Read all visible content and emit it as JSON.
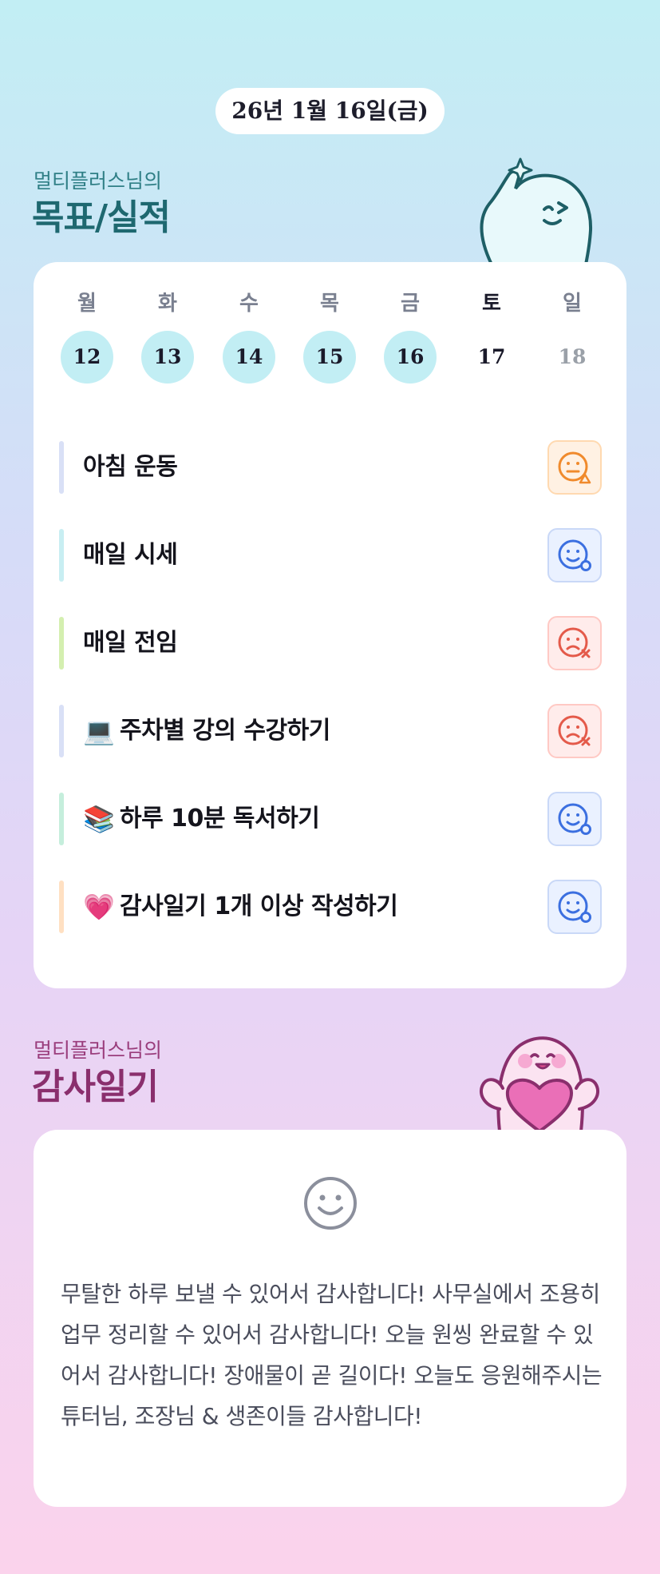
{
  "header": {
    "date": "26년 1월 16일(금)"
  },
  "goals_section": {
    "subtitle": "멀티플러스님의",
    "title": "목표/실적",
    "days": [
      {
        "label": "월",
        "num": "12",
        "state": "done"
      },
      {
        "label": "화",
        "num": "13",
        "state": "done"
      },
      {
        "label": "수",
        "num": "14",
        "state": "done"
      },
      {
        "label": "목",
        "num": "15",
        "state": "done"
      },
      {
        "label": "금",
        "num": "16",
        "state": "done"
      },
      {
        "label": "토",
        "num": "17",
        "state": "today"
      },
      {
        "label": "일",
        "num": "18",
        "state": "future"
      }
    ],
    "goals": [
      {
        "emoji": "",
        "text": "아침 운동",
        "bar_color": "#d9e0f6",
        "status": "warn",
        "status_icon": "smile-warning-icon"
      },
      {
        "emoji": "",
        "text": "매일 시세",
        "bar_color": "#c8eef2",
        "status": "ok",
        "status_icon": "smile-check-icon"
      },
      {
        "emoji": "",
        "text": "매일 전임",
        "bar_color": "#d4efb0",
        "status": "fail",
        "status_icon": "smile-x-icon"
      },
      {
        "emoji": "💻",
        "text": "주차별 강의 수강하기",
        "bar_color": "#d9e0f6",
        "status": "fail",
        "status_icon": "smile-x-icon"
      },
      {
        "emoji": "📚",
        "text": "하루 10분 독서하기",
        "bar_color": "#c5eedc",
        "status": "ok",
        "status_icon": "smile-check-icon"
      },
      {
        "emoji": "💗",
        "text": "감사일기 1개 이상 작성하기",
        "bar_color": "#ffe0c2",
        "status": "ok",
        "status_icon": "smile-check-icon"
      }
    ],
    "colors": {
      "warn": "#f08a2c",
      "ok": "#3b6fe0",
      "fail": "#e45a4a"
    }
  },
  "gratitude_section": {
    "subtitle": "멀티플러스님의",
    "title": "감사일기",
    "icon": "smile-icon",
    "text": "무탈한 하루 보낼 수 있어서 감사합니다! 사무실에서 조용히 업무 정리할 수 있어서 감사합니다! 오늘 원씽 완료할 수 있어서 감사합니다! 장애물이 곧 길이다! 오늘도 응원해주시는 튜터님, 조장님 & 생존이들 감사합니다!"
  }
}
